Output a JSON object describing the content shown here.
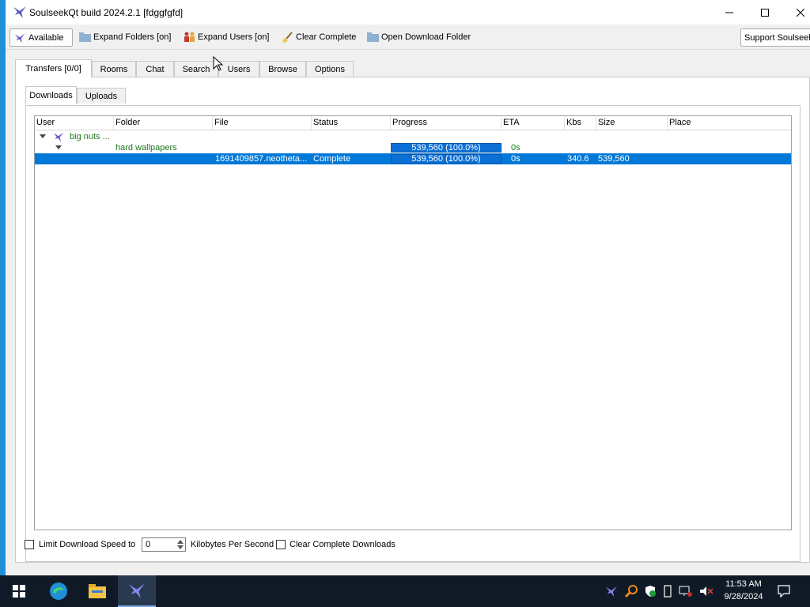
{
  "window": {
    "title": "SoulseekQt build 2024.2.1 [fdggfgfd]"
  },
  "toolbar": {
    "status_label": "Available",
    "expand_folders": "Expand Folders [on]",
    "expand_users": "Expand Users [on]",
    "clear_complete": "Clear Complete",
    "open_download_folder": "Open Download Folder",
    "support": "Support Soulseek"
  },
  "tabs": [
    "Transfers [0/0]",
    "Rooms",
    "Chat",
    "Search",
    "Users",
    "Browse",
    "Options"
  ],
  "subtabs": [
    "Downloads",
    "Uploads"
  ],
  "columns": [
    "User",
    "Folder",
    "File",
    "Status",
    "Progress",
    "ETA",
    "Kbs",
    "Size",
    "Place"
  ],
  "rows": {
    "user": {
      "name": "big nuts ..."
    },
    "folder": {
      "name": "hard wallpapers",
      "progress_text": "539,560 (100.0%)",
      "progress": 100,
      "eta": "0s"
    },
    "file": {
      "name": "1691409857.neotheta...",
      "status": "Complete",
      "progress_text": "539,560 (100.0%)",
      "progress": 100,
      "eta": "0s",
      "kbs": "340.6",
      "size": "539,560"
    }
  },
  "bottom": {
    "limit_label": "Limit Download Speed to",
    "limit_value": "0",
    "unit_label": "Kilobytes Per Second",
    "clear_label": "Clear Complete Downloads"
  },
  "taskbar": {
    "time": "11:53 AM",
    "date": "9/28/2024"
  },
  "colors": {
    "selection": "#0078d7",
    "progress": "#0a6fd6",
    "green_text": "#1a7a1a",
    "taskbar": "#101a26"
  }
}
